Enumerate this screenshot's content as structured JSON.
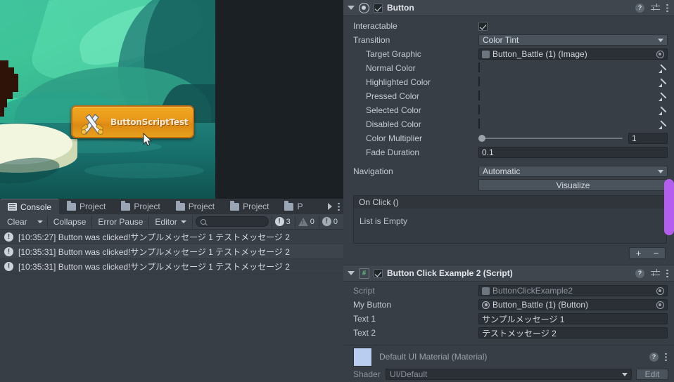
{
  "game": {
    "button_label": "ButtonScriptTest",
    "button_icon": "crossed-swords-icon",
    "cursor": "mouse-cursor"
  },
  "console": {
    "tabs": [
      {
        "label": "Console",
        "icon": "console-icon",
        "active": true
      },
      {
        "label": "Project",
        "icon": "folder-icon",
        "active": false
      },
      {
        "label": "Project",
        "icon": "folder-icon",
        "active": false
      },
      {
        "label": "Project",
        "icon": "folder-icon",
        "active": false
      },
      {
        "label": "Project",
        "icon": "folder-icon",
        "active": false
      },
      {
        "label": "P",
        "icon": "folder-icon",
        "active": false
      }
    ],
    "toolbar": {
      "clear": "Clear",
      "collapse": "Collapse",
      "error_pause": "Error Pause",
      "editor": "Editor",
      "search_placeholder": "",
      "search_value": "",
      "error_count": "3",
      "warning_count": "0",
      "info_count": "0"
    },
    "logs": [
      {
        "icon": "error-icon",
        "text": "[10:35:27] Button was clicked!サンプルメッセージ 1  テストメッセージ 2"
      },
      {
        "icon": "error-icon",
        "text": "[10:35:31] Button was clicked!サンプルメッセージ 1  テストメッセージ 2"
      },
      {
        "icon": "error-icon",
        "text": "[10:35:31] Button was clicked!サンプルメッセージ 1  テストメッセージ 2"
      }
    ]
  },
  "inspector": {
    "button_component": {
      "title": "Button",
      "enabled": true,
      "fields": {
        "interactable_label": "Interactable",
        "interactable_value": true,
        "transition_label": "Transition",
        "transition_value": "Color Tint",
        "target_graphic_label": "Target Graphic",
        "target_graphic_value": "Button_Battle (1) (Image)",
        "normal_color_label": "Normal Color",
        "normal_color_value": "#FFFFFF",
        "highlighted_color_label": "Highlighted Color",
        "highlighted_color_value": "#F5F5F5",
        "pressed_color_label": "Pressed Color",
        "pressed_color_value": "#C8C8C8",
        "selected_color_label": "Selected Color",
        "selected_color_value": "#F5F5F5",
        "disabled_color_label": "Disabled Color",
        "disabled_color_value": "#C8C8C8",
        "disabled_color_alpha": "50",
        "color_multiplier_label": "Color Multiplier",
        "color_multiplier_value": "1",
        "fade_duration_label": "Fade Duration",
        "fade_duration_value": "0.1",
        "navigation_label": "Navigation",
        "navigation_value": "Automatic",
        "visualize_label": "Visualize"
      },
      "on_click": {
        "header": "On Click ()",
        "empty_text": "List is Empty",
        "add_label": "+",
        "remove_label": "−"
      }
    },
    "script_component": {
      "title": "Button Click Example 2 (Script)",
      "enabled": true,
      "rows": [
        {
          "label": "Script",
          "value": "ButtonClickExample2",
          "type": "object",
          "dim": true
        },
        {
          "label": "My Button",
          "value": "Button_Battle (1) (Button)",
          "type": "object",
          "dim": false
        },
        {
          "label": "Text 1",
          "value": "サンプルメッセージ 1",
          "type": "text"
        },
        {
          "label": "Text 2",
          "value": "テストメッセージ 2",
          "type": "text"
        }
      ]
    },
    "material": {
      "title": "Default UI Material (Material)",
      "shader_label": "Shader",
      "shader_value": "UI/Default",
      "edit_label": "Edit"
    }
  },
  "colors": {
    "accent_purple": "#B45EF0",
    "panel_bg": "#383E45",
    "header_bg": "#3F464E",
    "button_gold": "#E8971A"
  }
}
